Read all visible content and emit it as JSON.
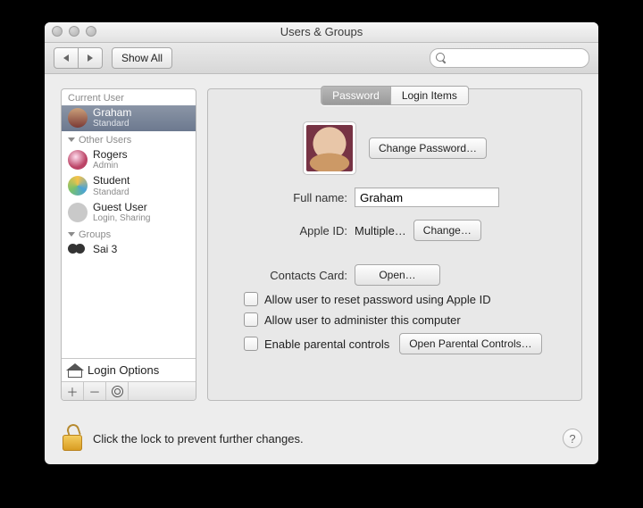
{
  "window": {
    "title": "Users & Groups"
  },
  "toolbar": {
    "show_all": "Show All",
    "search_placeholder": ""
  },
  "sidebar": {
    "headers": {
      "current": "Current User",
      "other": "Other Users",
      "groups": "Groups"
    },
    "current": {
      "name": "Graham",
      "role": "Standard"
    },
    "others": [
      {
        "name": "Rogers",
        "role": "Admin"
      },
      {
        "name": "Student",
        "role": "Standard"
      },
      {
        "name": "Guest User",
        "role": "Login, Sharing"
      }
    ],
    "groups": [
      {
        "name": "Sai 3"
      }
    ],
    "login_options": "Login Options"
  },
  "tabs": {
    "password": "Password",
    "login_items": "Login Items"
  },
  "panel": {
    "change_password": "Change Password…",
    "fullname_label": "Full name:",
    "fullname_value": "Graham",
    "appleid_label": "Apple ID:",
    "appleid_value": "Multiple…",
    "change": "Change…",
    "contacts_label": "Contacts Card:",
    "open": "Open…",
    "chk_reset": "Allow user to reset password using Apple ID",
    "chk_admin": "Allow user to administer this computer",
    "chk_parental": "Enable parental controls",
    "open_parental": "Open Parental Controls…"
  },
  "footer": {
    "lock_text": "Click the lock to prevent further changes."
  },
  "avatar_colors": {
    "graham": "linear-gradient(#caa07a,#7b3a35)",
    "rogers": "radial-gradient(circle at 40% 35%,#fde,#b46 60%)",
    "student": "conic-gradient(#f6c24a,#4aa3d6,#7bc26b,#f6c24a)",
    "guest": "#c9c9c9"
  }
}
